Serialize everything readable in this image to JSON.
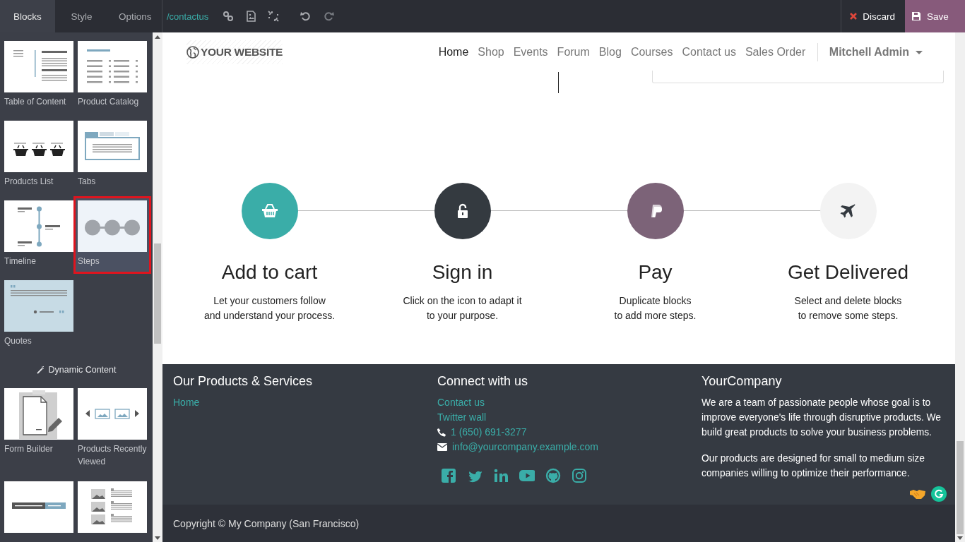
{
  "editor_tabs": [
    {
      "label": "Blocks",
      "selected": true
    },
    {
      "label": "Style",
      "selected": false
    },
    {
      "label": "Options",
      "selected": false
    }
  ],
  "page_path": "/contactus",
  "discard": "Discard",
  "save": "Save",
  "blocks": [
    {
      "label": "Table of Content",
      "kind": "toc",
      "selected": false
    },
    {
      "label": "Product Catalog",
      "kind": "catalog",
      "selected": false
    },
    {
      "label": "Products List",
      "kind": "baskets",
      "selected": false
    },
    {
      "label": "Tabs",
      "kind": "tabs",
      "selected": false
    },
    {
      "label": "Timeline",
      "kind": "timeline",
      "selected": false
    },
    {
      "label": "Steps",
      "kind": "steps",
      "selected": true
    },
    {
      "label": "Quotes",
      "kind": "quotes",
      "selected": false
    }
  ],
  "dynamic_heading": "Dynamic Content",
  "dynamic_blocks": [
    {
      "label": "Form Builder",
      "kind": "form",
      "selected": false
    },
    {
      "label": "Products Recently Viewed",
      "kind": "carousel",
      "selected": false
    },
    {
      "kind": "search",
      "selected": false
    },
    {
      "kind": "blog",
      "selected": false
    }
  ],
  "site": {
    "logo": "YOUR WEBSITE",
    "menu": [
      {
        "label": "Home",
        "selected": true
      },
      {
        "label": "Shop",
        "selected": false
      },
      {
        "label": "Events",
        "selected": false
      },
      {
        "label": "Forum",
        "selected": false
      },
      {
        "label": "Blog",
        "selected": false
      },
      {
        "label": "Courses",
        "selected": false
      },
      {
        "label": "Contact us",
        "selected": false
      },
      {
        "label": "Sales Order",
        "selected": false
      }
    ],
    "user": "Mitchell Admin"
  },
  "steps": [
    {
      "kind": "basket",
      "color": "#3aada8",
      "title": "Add to cart",
      "lines": [
        "Let your customers follow",
        "and understand your process."
      ]
    },
    {
      "kind": "lock",
      "color": "#343a40",
      "title": "Sign in",
      "lines": [
        "Click on the icon to adapt it",
        "to your purpose."
      ]
    },
    {
      "kind": "payment",
      "color": "#7c6378",
      "title": "Pay",
      "lines": [
        "Duplicate blocks",
        "to add more steps."
      ]
    },
    {
      "kind": "plane",
      "color": "#f3f3f3",
      "title": "Get Delivered",
      "lines": [
        "Select and delete blocks",
        "to remove some steps."
      ]
    }
  ],
  "footer": {
    "columns": [
      {
        "title": "Our Products & Services",
        "links": [
          {
            "kind": "link",
            "text": "Home"
          }
        ]
      },
      {
        "title": "Connect with us",
        "links": [
          {
            "kind": "link",
            "text": "Contact us"
          },
          {
            "kind": "link",
            "text": "Twitter wall"
          },
          {
            "kind": "phone",
            "text": "1 (650) 691-3277"
          },
          {
            "kind": "email",
            "text": "info@yourcompany.example.com"
          }
        ],
        "social": [
          {
            "kind": "facebook"
          },
          {
            "kind": "twitter"
          },
          {
            "kind": "linkedin"
          },
          {
            "kind": "youtube"
          },
          {
            "kind": "github"
          },
          {
            "kind": "instagram"
          }
        ]
      },
      {
        "title": "YourCompany",
        "paragraphs": [
          "We are a team of passionate people whose goal is to improve everyone's life through disruptive products. We build great products to solve your business problems.",
          "Our products are designed for small to medium size companies willing to optimize their performance."
        ]
      }
    ],
    "copyright": "Copyright © My Company (San Francisco)"
  }
}
